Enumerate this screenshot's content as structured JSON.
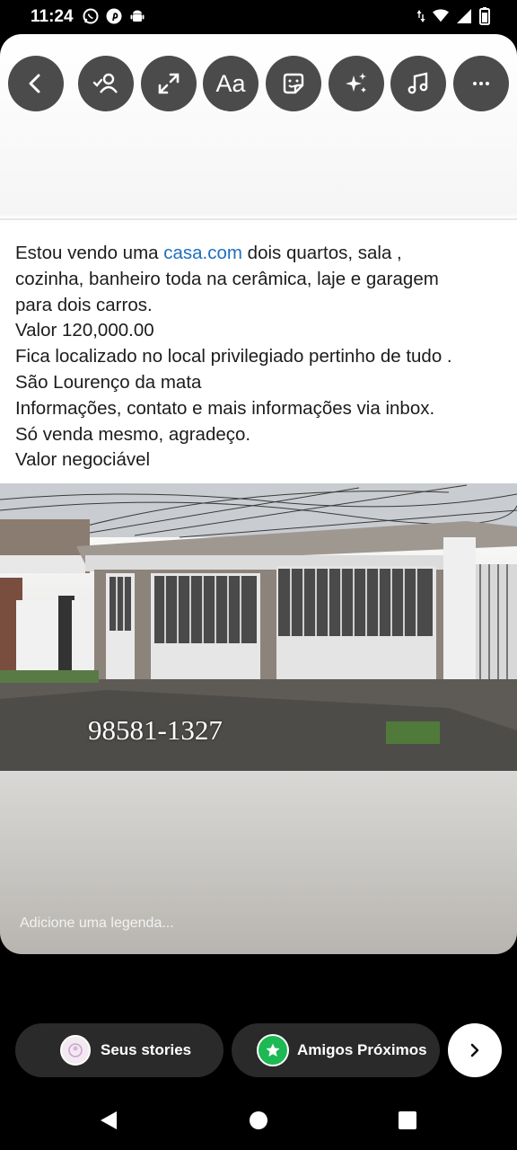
{
  "status_bar": {
    "time": "11:24",
    "left_icons": [
      "whatsapp-icon",
      "pinterest-icon",
      "android-icon"
    ],
    "right_icons": [
      "data-arrows-icon",
      "wifi-icon",
      "signal-icon",
      "battery-icon"
    ]
  },
  "toolbar": {
    "buttons": [
      "back-icon",
      "tag-people-icon",
      "expand-icon",
      "text-icon",
      "sticker-icon",
      "effects-icon",
      "music-icon",
      "more-icon"
    ],
    "text_label": "Aa"
  },
  "post": {
    "line1_pre": "Estou vendo uma ",
    "line1_link": "casa.com",
    "line1_post": " dois quartos, sala ,",
    "line2": "cozinha, banheiro toda na cerâmica, laje e garagem",
    "line3": "para dois carros.",
    "line4": "Valor 120,000.00",
    "line5": "Fica localizado no local privilegiado pertinho de tudo .",
    "line6": "São Lourenço da mata",
    "line7": "Informações,  contato e mais informações via inbox.",
    "line8": "Só venda  mesmo, agradeço.",
    "line9": "Valor negociável"
  },
  "photo": {
    "phone_overlay": "98581-1327"
  },
  "caption_placeholder": "Adicione uma legenda...",
  "bottom": {
    "your_stories": "Seus stories",
    "close_friends": "Amigos Próximos"
  },
  "colors": {
    "link": "#1e6fc1",
    "close_friends_green": "#1db954",
    "toolbar_button": "#4b4b4b"
  }
}
